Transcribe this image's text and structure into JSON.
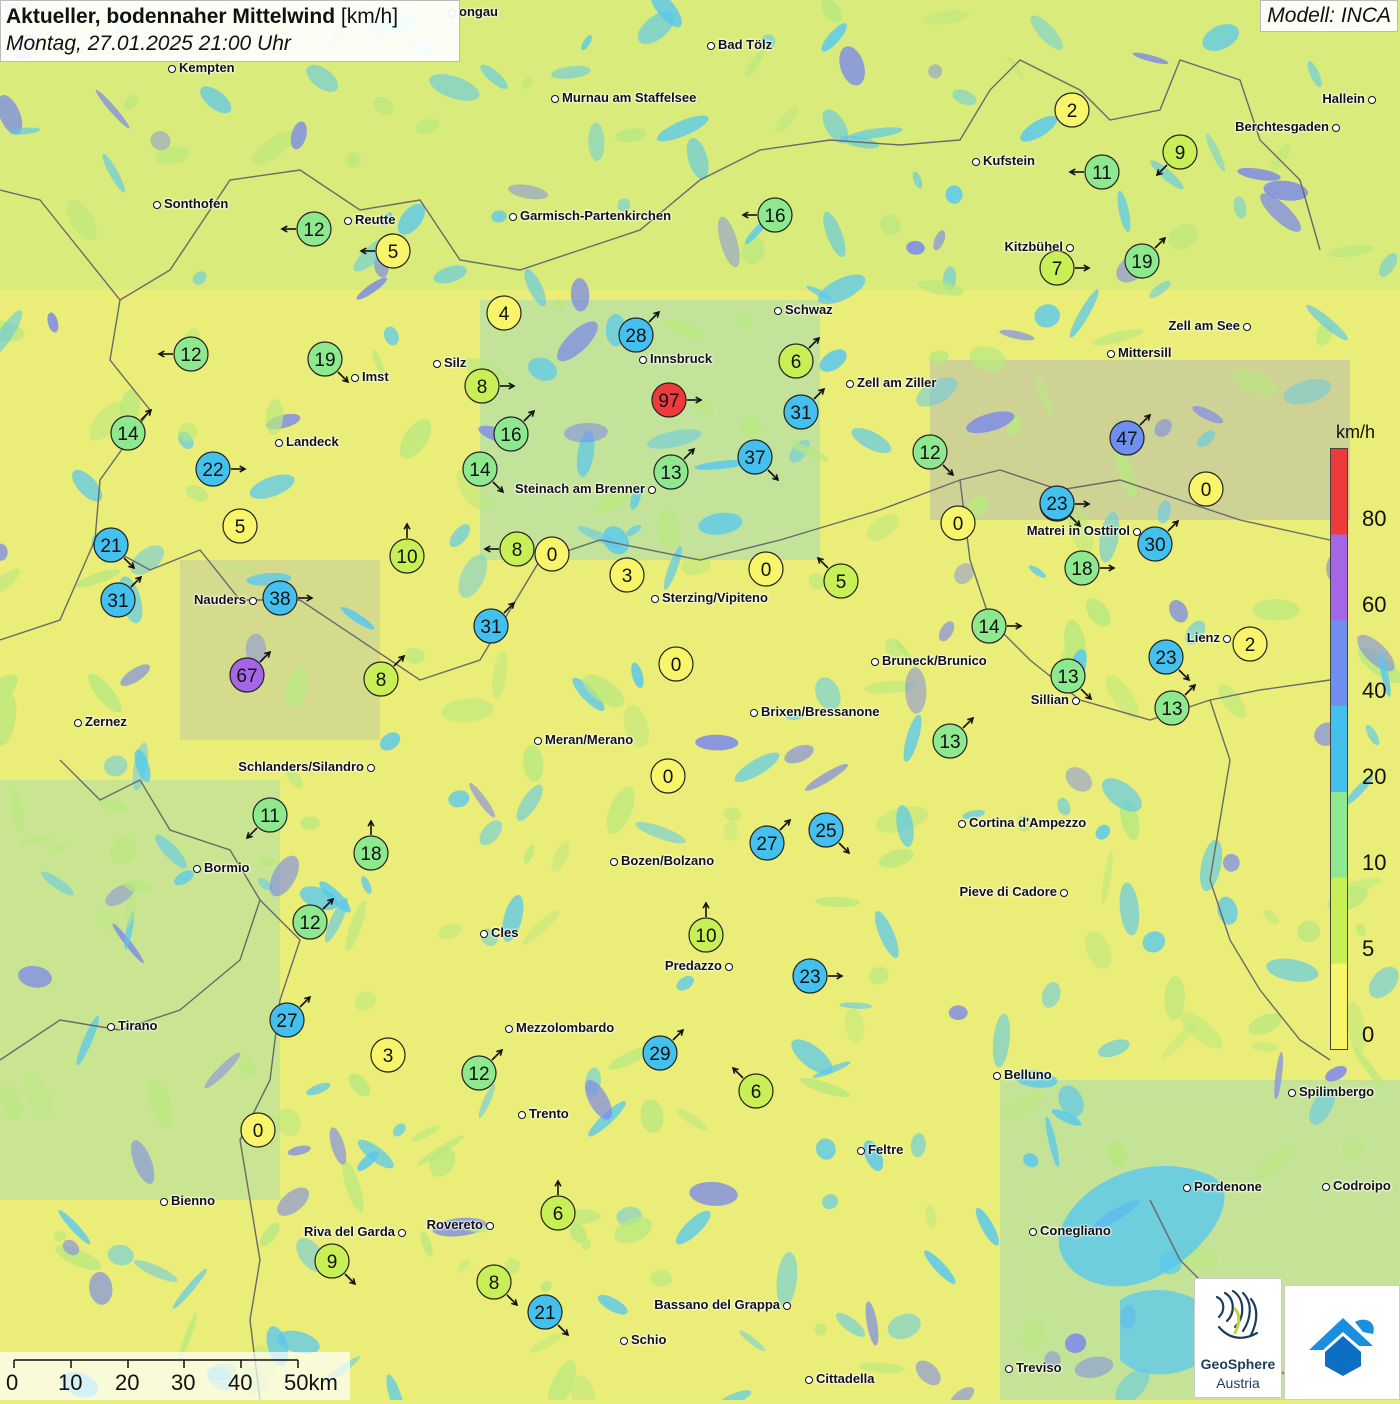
{
  "header": {
    "title_bold": "Aktueller, bodennaher Mittelwind",
    "title_unit": "[km/h]",
    "subtitle": "Montag, 27.01.2025 21:00 Uhr",
    "model": "Modell: INCA"
  },
  "legend": {
    "unit": "km/h",
    "ticks": [
      "80",
      "60",
      "40",
      "20",
      "10",
      "5",
      "0"
    ],
    "colors": [
      "#ee3a3a",
      "#a466e6",
      "#6e8ef0",
      "#44c0ef",
      "#8ee88e",
      "#c8ef55",
      "#f8f56a"
    ]
  },
  "scalebar": {
    "labels": [
      "0",
      "10",
      "20",
      "30",
      "40",
      "50km"
    ]
  },
  "logo": {
    "line1": "GeoSphere",
    "line2": "Austria"
  },
  "colors": {
    "lowland": "#f2f07a",
    "moderate": "#b9e87f",
    "fast": "#58c8ef",
    "alpine": "#7a88ec"
  },
  "stations": [
    {
      "v": 2,
      "color": "#f8f56a",
      "dir": null
    },
    {
      "v": 9,
      "color": "#c8ef55",
      "dir": "sw"
    },
    {
      "v": 11,
      "color": "#8ee88e",
      "dir": "w"
    },
    {
      "v": 16,
      "color": "#8ee88e",
      "dir": "w"
    },
    {
      "v": 12,
      "color": "#8ee88e",
      "dir": "w"
    },
    {
      "v": 5,
      "color": "#f8f56a",
      "dir": "w"
    },
    {
      "v": 7,
      "color": "#c8ef55",
      "dir": "e"
    },
    {
      "v": 19,
      "color": "#8ee88e",
      "dir": "ne"
    },
    {
      "v": 4,
      "color": "#f8f56a",
      "dir": null
    },
    {
      "v": 28,
      "color": "#44c0ef",
      "dir": "ne"
    },
    {
      "v": 12,
      "color": "#8ee88e",
      "dir": "w"
    },
    {
      "v": 19,
      "color": "#8ee88e",
      "dir": "se"
    },
    {
      "v": 8,
      "color": "#c8ef55",
      "dir": "e"
    },
    {
      "v": 6,
      "color": "#c8ef55",
      "dir": "ne"
    },
    {
      "v": 97,
      "color": "#ee3a3a",
      "dir": "e"
    },
    {
      "v": 31,
      "color": "#44c0ef",
      "dir": "ne"
    },
    {
      "v": 14,
      "color": "#8ee88e",
      "dir": "ne"
    },
    {
      "v": 16,
      "color": "#8ee88e",
      "dir": "ne"
    },
    {
      "v": 22,
      "color": "#44c0ef",
      "dir": "e"
    },
    {
      "v": 14,
      "color": "#8ee88e",
      "dir": "se"
    },
    {
      "v": 13,
      "color": "#8ee88e",
      "dir": "ne"
    },
    {
      "v": 37,
      "color": "#44c0ef",
      "dir": "se"
    },
    {
      "v": 12,
      "color": "#8ee88e",
      "dir": "se"
    },
    {
      "v": 47,
      "color": "#6e8ef0",
      "dir": "ne"
    },
    {
      "v": 0,
      "color": "#f8f56a",
      "dir": null
    },
    {
      "v": 23,
      "color": "#44c0ef",
      "dir": "e"
    },
    {
      "v": 5,
      "color": "#f8f56a",
      "dir": null
    },
    {
      "v": 21,
      "color": "#44c0ef",
      "dir": "se"
    },
    {
      "v": 10,
      "color": "#c8ef55",
      "dir": "n"
    },
    {
      "v": 8,
      "color": "#c8ef55",
      "dir": "w"
    },
    {
      "v": 0,
      "color": "#f8f56a",
      "dir": null
    },
    {
      "v": 3,
      "color": "#f8f56a",
      "dir": null
    },
    {
      "v": 0,
      "color": "#f8f56a",
      "dir": null
    },
    {
      "v": 5,
      "color": "#c8ef55",
      "dir": "nw"
    },
    {
      "v": 0,
      "color": "#f8f56a",
      "dir": null
    },
    {
      "v": 23,
      "color": "#44c0ef",
      "dir": "se"
    },
    {
      "v": 30,
      "color": "#44c0ef",
      "dir": "ne"
    },
    {
      "v": 18,
      "color": "#8ee88e",
      "dir": "e"
    },
    {
      "v": 31,
      "color": "#44c0ef",
      "dir": "ne"
    },
    {
      "v": 38,
      "color": "#44c0ef",
      "dir": "e"
    },
    {
      "v": 31,
      "color": "#44c0ef",
      "dir": "ne"
    },
    {
      "v": 14,
      "color": "#8ee88e",
      "dir": "e"
    },
    {
      "v": 2,
      "color": "#f8f56a",
      "dir": null
    },
    {
      "v": 67,
      "color": "#a466e6",
      "dir": "ne"
    },
    {
      "v": 8,
      "color": "#c8ef55",
      "dir": "ne"
    },
    {
      "v": 0,
      "color": "#f8f56a",
      "dir": null
    },
    {
      "v": 13,
      "color": "#8ee88e",
      "dir": "se"
    },
    {
      "v": 23,
      "color": "#44c0ef",
      "dir": "se"
    },
    {
      "v": 13,
      "color": "#8ee88e",
      "dir": "ne"
    },
    {
      "v": 13,
      "color": "#8ee88e",
      "dir": "ne"
    },
    {
      "v": 0,
      "color": "#f8f56a",
      "dir": null
    },
    {
      "v": 11,
      "color": "#8ee88e",
      "dir": "sw"
    },
    {
      "v": 18,
      "color": "#8ee88e",
      "dir": "n"
    },
    {
      "v": 27,
      "color": "#44c0ef",
      "dir": "ne"
    },
    {
      "v": 25,
      "color": "#44c0ef",
      "dir": "se"
    },
    {
      "v": 12,
      "color": "#8ee88e",
      "dir": "ne"
    },
    {
      "v": 10,
      "color": "#c8ef55",
      "dir": "n"
    },
    {
      "v": 23,
      "color": "#44c0ef",
      "dir": "e"
    },
    {
      "v": 27,
      "color": "#44c0ef",
      "dir": "ne"
    },
    {
      "v": 3,
      "color": "#f8f56a",
      "dir": null
    },
    {
      "v": 12,
      "color": "#8ee88e",
      "dir": "ne"
    },
    {
      "v": 29,
      "color": "#44c0ef",
      "dir": "ne"
    },
    {
      "v": 6,
      "color": "#c8ef55",
      "dir": "nw"
    },
    {
      "v": 0,
      "color": "#f8f56a",
      "dir": null
    },
    {
      "v": 6,
      "color": "#c8ef55",
      "dir": "n"
    },
    {
      "v": 9,
      "color": "#c8ef55",
      "dir": "se"
    },
    {
      "v": 8,
      "color": "#c8ef55",
      "dir": "se"
    },
    {
      "v": 21,
      "color": "#44c0ef",
      "dir": "se"
    }
  ],
  "cities": [
    "Kempten",
    "Bad Tölz",
    "Murnau am Staffelsee",
    "Hallein",
    "Berchtesgaden",
    "Kufstein",
    "Sonthofen",
    "Reutte",
    "Garmisch-Partenkirchen",
    "Kitzbühel",
    "Schwaz",
    "Zell am See",
    "Innsbruck",
    "Mittersill",
    "Silz",
    "Imst",
    "Zell am Ziller",
    "Landeck",
    "Steinach am Brenner",
    "Matrei in Osttirol",
    "Sterzing/Vipiteno",
    "Nauders",
    "Lienz",
    "Bruneck/Brunico",
    "Sillian",
    "Zernez",
    "Brixen/Bressanone",
    "Meran/Merano",
    "Schlanders/Silandro",
    "Cortina d'Ampezzo",
    "Bormio",
    "Bozen/Bolzano",
    "Pieve di Cadore",
    "Cles",
    "Predazzo",
    "Tirano",
    "Mezzolombardo",
    "Belluno",
    "Spilimbergo",
    "Trento",
    "Feltre",
    "Pordenone",
    "Codroipo",
    "Bienno",
    "Riva del Garda",
    "Rovereto",
    "Conegliano",
    "Bassano del Grappa",
    "Schio",
    "Treviso",
    "Cittadella",
    "ongau"
  ]
}
